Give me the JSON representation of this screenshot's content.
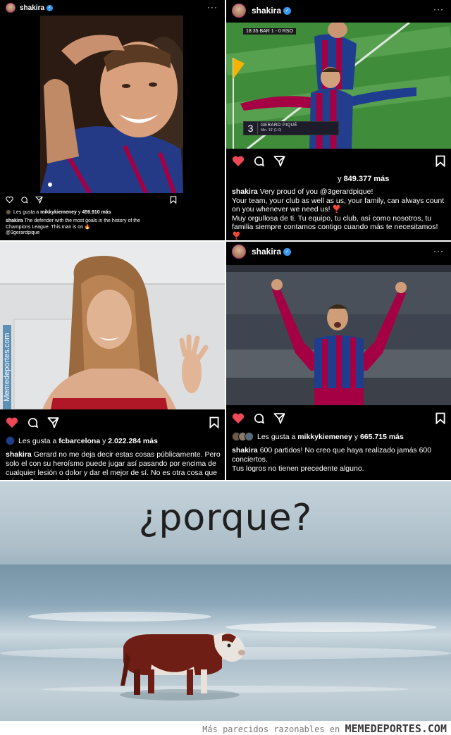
{
  "post1": {
    "username": "shakira",
    "likes_prefix": "Les gusta a",
    "likes_user": "mikkykiemeney",
    "likes_suffix": "y",
    "likes_count": "459.910 más",
    "caption_user": "shakira",
    "caption_text": "The defender with the most goals in the history of the Champions League. This man is on 🔥",
    "caption_tag": "@3gerardpique"
  },
  "post2": {
    "username": "shakira",
    "score_text": "18:35 BAR 1 - 0 RSO",
    "player_number": "3",
    "player_name": "GERARD PIQUÉ",
    "player_min": "Min. 19' (1-0)",
    "likes_suffix": "y",
    "likes_count": "849.377 más",
    "caption_user": "shakira",
    "caption_line1": "Very proud of you @3gerardpique!",
    "caption_line2": "Your team, your club as well as us, your family, can always count on you whenever we need us! ❣️",
    "caption_line3": "Muy orgullosa de ti. Tu equipo, tu club, así como nosotros, tu familia siempre contamos contigo cuando más te necesitamos! ❣️"
  },
  "post3": {
    "likes_prefix": "Les gusta a",
    "likes_user": "fcbarcelona",
    "likes_suffix": "y",
    "likes_count": "2.022.284 más",
    "caption_user": "shakira",
    "caption_text": "Gerard no me deja decir estas cosas públicamente. Pero solo el con su heroísmo puede jugar así pasando por encima de cualquier lesión o dolor y dar el mejor de sí. No es otra cosa que mi orgullo, y esto al",
    "watermark": "Memedeportes.com"
  },
  "post4": {
    "username": "shakira",
    "likes_prefix": "Les gusta a",
    "likes_user": "mikkykiemeney",
    "likes_suffix": "y",
    "likes_count": "665.715 más",
    "caption_user": "shakira",
    "caption_line1": "600 partidos! No creo que haya realizado jamás 600 conciertos.",
    "caption_line2": "Tus logros no tienen precedente alguno."
  },
  "meme": {
    "title": "¿porque?"
  },
  "credit": {
    "text": "Más parecidos razonables en",
    "site": "MEMEDEPORTES.COM"
  },
  "colors": {
    "like_red": "#ed4956",
    "verified_blue": "#3897f0",
    "barca_blue": "#1f3d8f",
    "barca_red": "#a50044",
    "pitch_green": "#3e8a3a"
  },
  "icons": [
    "heart-icon",
    "comment-icon",
    "share-icon",
    "bookmark-icon",
    "more-icon",
    "verified-icon"
  ]
}
